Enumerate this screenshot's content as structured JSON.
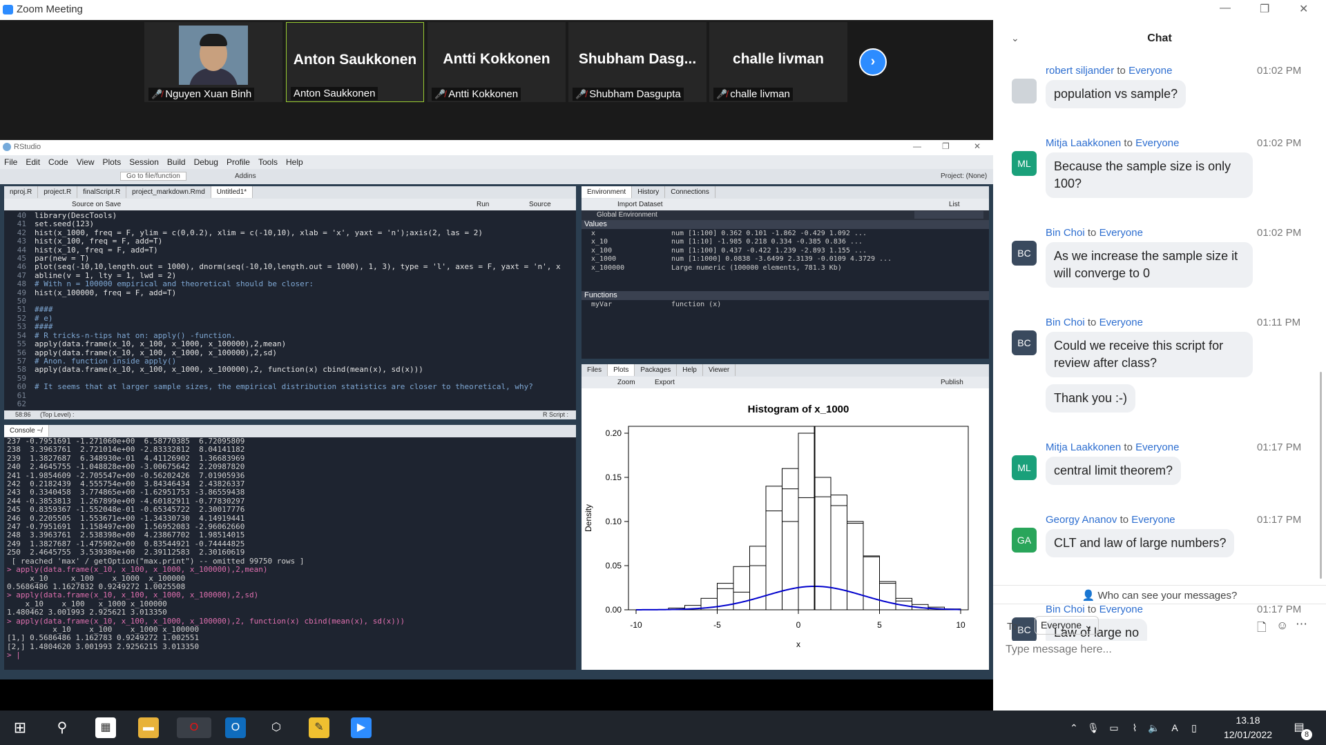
{
  "zoom": {
    "title": "Zoom Meeting",
    "participants": [
      {
        "big": "",
        "name": "Nguyen Xuan Binh",
        "muted": true,
        "has_video": true
      },
      {
        "big": "Anton Saukkonen",
        "name": "Anton Saukkonen",
        "muted": false,
        "active": true
      },
      {
        "big": "Antti Kokkonen",
        "name": "Antti Kokkonen",
        "muted": true
      },
      {
        "big": "Shubham  Dasg...",
        "name": "Shubham Dasgupta",
        "muted": true
      },
      {
        "big": "challe livman",
        "name": "challe livman",
        "muted": true
      }
    ]
  },
  "rstudio": {
    "title": "RStudio",
    "menu": [
      "File",
      "Edit",
      "Code",
      "View",
      "Plots",
      "Session",
      "Build",
      "Debug",
      "Profile",
      "Tools",
      "Help"
    ],
    "toolbar": {
      "goto": "Go to file/function",
      "addins": "Addins",
      "project": "Project: (None)"
    },
    "editor_tabs": [
      "nproj.R",
      "project.R",
      "finalScript.R",
      "project_markdown.Rmd",
      "Untitled1*"
    ],
    "editor_tools": {
      "source_on_save": "Source on Save",
      "run": "Run",
      "source": "Source"
    },
    "code_lines": [
      {
        "n": "40",
        "t": "library(DescTools)",
        "c": "fn"
      },
      {
        "n": "41",
        "t": "set.seed(123)",
        "c": "fn"
      },
      {
        "n": "42",
        "t": "hist(x_1000, freq = F, ylim = c(0,0.2), xlim = c(-10,10), xlab = 'x', yaxt = 'n');axis(2, las = 2)",
        "c": "fn"
      },
      {
        "n": "43",
        "t": "hist(x_100, freq = F, add=T)",
        "c": "fn"
      },
      {
        "n": "44",
        "t": "hist(x_10, freq = F, add=T)",
        "c": "fn"
      },
      {
        "n": "45",
        "t": "par(new = T)",
        "c": "fn"
      },
      {
        "n": "46",
        "t": "plot(seq(-10,10,length.out = 1000), dnorm(seq(-10,10,length.out = 1000), 1, 3), type = 'l', axes = F, yaxt = 'n', x",
        "c": "fn"
      },
      {
        "n": "47",
        "t": "abline(v = 1, lty = 1, lwd = 2)",
        "c": "fn"
      },
      {
        "n": "48",
        "t": "# With n = 100000 empirical and theoretical should be closer:",
        "c": "cmt"
      },
      {
        "n": "49",
        "t": "hist(x_100000, freq = F, add=T)",
        "c": "fn"
      },
      {
        "n": "50",
        "t": "",
        "c": "fn"
      },
      {
        "n": "51",
        "t": "####",
        "c": "cmt"
      },
      {
        "n": "52",
        "t": "# e)",
        "c": "cmt"
      },
      {
        "n": "53",
        "t": "####",
        "c": "cmt"
      },
      {
        "n": "54",
        "t": "# R tricks-n-tips hat on: apply() -function.",
        "c": "cmt"
      },
      {
        "n": "55",
        "t": "apply(data.frame(x_10, x_100, x_1000, x_100000),2,mean)",
        "c": "fn"
      },
      {
        "n": "56",
        "t": "apply(data.frame(x_10, x_100, x_1000, x_100000),2,sd)",
        "c": "fn"
      },
      {
        "n": "57",
        "t": "# Anon. function inside apply()",
        "c": "cmt"
      },
      {
        "n": "58",
        "t": "apply(data.frame(x_10, x_100, x_1000, x_100000),2, function(x) cbind(mean(x), sd(x)))",
        "c": "fn"
      },
      {
        "n": "59",
        "t": "",
        "c": "fn"
      },
      {
        "n": "60",
        "t": "# It seems that at larger sample sizes, the empirical distribution statistics are closer to theoretical, why?",
        "c": "cmt"
      },
      {
        "n": "61",
        "t": "",
        "c": "fn"
      },
      {
        "n": "62",
        "t": "",
        "c": "fn"
      }
    ],
    "editor_status": {
      "pos": "58:86",
      "scope": "(Top Level) :",
      "type": "R Script :"
    },
    "env_tabs": [
      "Environment",
      "History",
      "Connections"
    ],
    "env_tools": {
      "import": "Import Dataset",
      "list": "List",
      "global": "Global Environment"
    },
    "env_values_header": "Values",
    "env_values": [
      {
        "name": "x",
        "val": "num [1:100] 0.362 0.101 -1.862 -0.429 1.092 ..."
      },
      {
        "name": "x_10",
        "val": "num [1:10] -1.985 0.218 0.334 -0.385 0.836 ..."
      },
      {
        "name": "x_100",
        "val": "num [1:100] 0.437 -0.422 1.239 -2.893 1.155 ..."
      },
      {
        "name": "x_1000",
        "val": "num [1:1000] 0.0838 -3.6499 2.3139 -0.0109 4.3729 ..."
      },
      {
        "name": "x_100000",
        "val": "Large numeric (100000 elements, 781.3 Kb)"
      }
    ],
    "env_functions_header": "Functions",
    "env_functions": [
      {
        "name": "myVar",
        "val": "function (x)"
      }
    ],
    "files_tabs": [
      "Files",
      "Plots",
      "Packages",
      "Help",
      "Viewer"
    ],
    "plot_tools": {
      "zoom": "Zoom",
      "export": "Export",
      "publish": "Publish"
    },
    "console_header": "Console ~/",
    "console_lines": [
      {
        "t": "237 -0.7951691 -1.271060e+00  6.58770385  6.72095809",
        "c": "out"
      },
      {
        "t": "238  3.3963761  2.721014e+00 -2.83332812  8.04141182",
        "c": "out"
      },
      {
        "t": "239  1.3827687  6.348930e-01  4.41126902  1.36683969",
        "c": "out"
      },
      {
        "t": "240  2.4645755 -1.048828e+00 -3.00675642  2.20987820",
        "c": "out"
      },
      {
        "t": "241 -1.9854609 -2.705547e+00 -0.56202426  7.01905936",
        "c": "out"
      },
      {
        "t": "242  0.2182439  4.555754e+00  3.84346434  2.43826337",
        "c": "out"
      },
      {
        "t": "243  0.3340458  3.774865e+00 -1.62951753 -3.86559438",
        "c": "out"
      },
      {
        "t": "244 -0.3853813  1.267899e+00 -4.60182911 -0.77830297",
        "c": "out"
      },
      {
        "t": "245  0.8359367 -1.552048e-01 -0.65345722  2.30017776",
        "c": "out"
      },
      {
        "t": "246  0.2205505  1.553671e+00 -1.34330730  4.14919441",
        "c": "out"
      },
      {
        "t": "247 -0.7951691  1.158497e+00  1.56952083 -2.96062660",
        "c": "out"
      },
      {
        "t": "248  3.3963761  2.538398e+00  4.23867702  1.98514015",
        "c": "out"
      },
      {
        "t": "249  1.3827687 -1.475902e+00  0.83544921 -0.74444825",
        "c": "out"
      },
      {
        "t": "250  2.4645755  3.539389e+00  2.39112583  2.30160619",
        "c": "out"
      },
      {
        "t": " [ reached 'max' / getOption(\"max.print\") -- omitted 99750 rows ]",
        "c": "out"
      },
      {
        "t": "> apply(data.frame(x_10, x_100, x_1000, x_100000),2,mean)",
        "c": "prompt"
      },
      {
        "t": "     x_10     x_100    x_1000  x_100000",
        "c": "out"
      },
      {
        "t": "0.5686486 1.1627832 0.9249272 1.0025508",
        "c": "out"
      },
      {
        "t": "> apply(data.frame(x_10, x_100, x_1000, x_100000),2,sd)",
        "c": "prompt"
      },
      {
        "t": "    x_10    x_100   x_1000 x_100000",
        "c": "out"
      },
      {
        "t": "1.480462 3.001993 2.925621 3.013350",
        "c": "out"
      },
      {
        "t": "> apply(data.frame(x_10, x_100, x_1000, x_100000),2, function(x) cbind(mean(x), sd(x)))",
        "c": "prompt"
      },
      {
        "t": "          x_10    x_100    x_1000 x_100000",
        "c": "out"
      },
      {
        "t": "[1,] 0.5686486 1.162783 0.9249272 1.002551",
        "c": "out"
      },
      {
        "t": "[2,] 1.4804620 3.001993 2.9256215 3.013350",
        "c": "out"
      },
      {
        "t": "> |",
        "c": "prompt"
      }
    ]
  },
  "chart_data": {
    "type": "bar",
    "title": "Histogram of x_1000",
    "xlabel": "x",
    "ylabel": "Density",
    "xlim": [
      -10,
      10
    ],
    "ylim": [
      0,
      0.2
    ],
    "x_ticks": [
      "-10",
      "-5",
      "0",
      "5",
      "10"
    ],
    "y_ticks": [
      "0.00",
      "0.05",
      "0.10",
      "0.15",
      "0.20"
    ],
    "bin_edges": [
      -10,
      -9,
      -8,
      -7,
      -6,
      -5,
      -4,
      -3,
      -2,
      -1,
      0,
      1,
      2,
      3,
      4,
      5,
      6,
      7,
      8,
      9,
      10
    ],
    "series": [
      {
        "values": [
          0,
          0,
          0.002,
          0.005,
          0.013,
          0.024,
          0.049,
          0.072,
          0.112,
          0.137,
          0.127,
          0.128,
          0.118,
          0.098,
          0.061,
          0.032,
          0.013,
          0.006,
          0.003,
          0.001
        ]
      },
      {
        "values": [
          0,
          0,
          0,
          0,
          0,
          0.03,
          0.02,
          0.05,
          0.14,
          0.16,
          0.2,
          0.15,
          0.13,
          0.1,
          0.06,
          0.03,
          0.01,
          0,
          0,
          0
        ]
      },
      {
        "values": [
          0,
          0,
          0,
          0,
          0,
          0,
          0,
          0,
          0,
          0.1,
          0.2,
          0,
          0,
          0.1,
          0,
          0,
          0,
          0,
          0,
          0
        ]
      }
    ],
    "density_curve": {
      "mean": 1,
      "sd": 3
    },
    "vline": 1
  },
  "chat": {
    "title": "Chat",
    "messages": [
      {
        "from": "robert siljander",
        "to": "Everyone",
        "time": "01:02 PM",
        "av": "",
        "avcolor": "#cfd4d9",
        "photo": true,
        "bubbles": [
          "population vs sample?"
        ]
      },
      {
        "from": "Mitja Laakkonen",
        "to": "Everyone",
        "time": "01:02 PM",
        "av": "ML",
        "avcolor": "#1aa07a",
        "bubbles": [
          "Because the sample size is only 100?"
        ]
      },
      {
        "from": "Bin Choi",
        "to": "Everyone",
        "time": "01:02 PM",
        "av": "BC",
        "avcolor": "#3a4a5e",
        "bubbles": [
          "As we increase the sample size it will converge to 0"
        ]
      },
      {
        "from": "Bin Choi",
        "to": "Everyone",
        "time": "01:11 PM",
        "av": "BC",
        "avcolor": "#3a4a5e",
        "bubbles": [
          "Could we receive this script for review after class?",
          "Thank you :-)"
        ]
      },
      {
        "from": "Mitja Laakkonen",
        "to": "Everyone",
        "time": "01:17 PM",
        "av": "ML",
        "avcolor": "#1aa07a",
        "bubbles": [
          "central limit theorem?"
        ]
      },
      {
        "from": "Georgy Ananov",
        "to": "Everyone",
        "time": "01:17 PM",
        "av": "GA",
        "avcolor": "#29a55a",
        "bubbles": [
          "CLT and law of large numbers?"
        ]
      },
      {
        "from": "Bin Choi",
        "to": "Everyone",
        "time": "01:17 PM",
        "av": "BC",
        "avcolor": "#3a4a5e",
        "bubbles": [
          "Law of large no"
        ]
      }
    ],
    "to_word": "to",
    "privacy": "Who can see your messages?",
    "to_label": "To:",
    "to_value": "Everyone",
    "placeholder": "Type message here..."
  },
  "taskbar": {
    "time": "13.18",
    "date": "12/01/2022",
    "notif_count": "8"
  }
}
